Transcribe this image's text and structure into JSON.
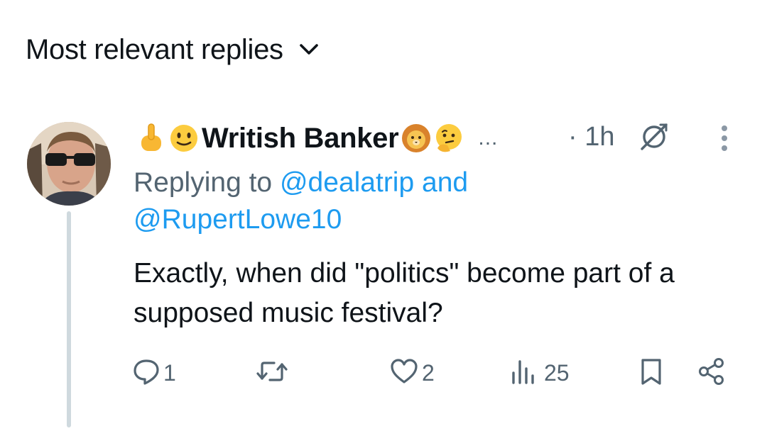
{
  "header": {
    "sort_label": "Most relevant replies"
  },
  "reply": {
    "display_name": "Writish Banker",
    "name_prefix_emojis": [
      "middle-finger-emoji",
      "slightly-smiling-emoji"
    ],
    "name_suffix_emojis": [
      "lion-emoji",
      "thinking-emoji"
    ],
    "name_truncation": "...",
    "timestamp": "· 1h",
    "replying_prefix": "Replying to",
    "replying_mention_1": "@dealatrip",
    "replying_and": "and",
    "replying_mention_2": "@RupertLowe10",
    "text": "Exactly, when did \"politics\" become part of a supposed music festival?",
    "actions": {
      "reply_count": "1",
      "repost_count": "",
      "like_count": "2",
      "view_count": "25"
    }
  },
  "colors": {
    "text": "#0f1419",
    "secondary": "#536471",
    "link": "#1d9bf0",
    "thread_line": "#cfd9de"
  },
  "icons": [
    "chevron-down-icon",
    "grok-icon",
    "more-vertical-icon",
    "reply-icon",
    "repost-icon",
    "like-icon",
    "views-icon",
    "bookmark-icon",
    "share-icon"
  ]
}
